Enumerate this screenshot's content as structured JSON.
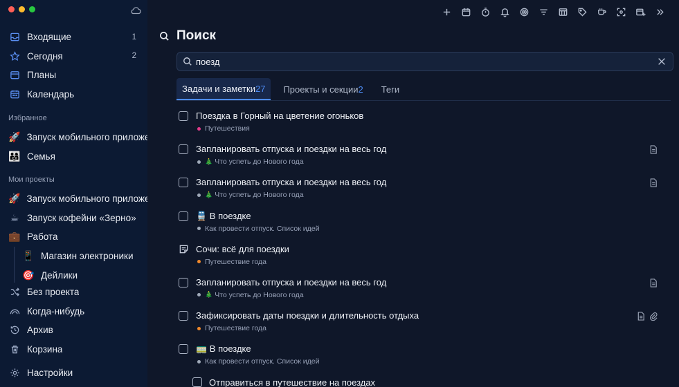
{
  "sidebar": {
    "items_top": [
      {
        "label": "Входящие",
        "count": "1",
        "icon": "inbox-icon"
      },
      {
        "label": "Сегодня",
        "count": "2",
        "icon": "star-icon"
      },
      {
        "label": "Планы",
        "count": "",
        "icon": "planner-icon"
      },
      {
        "label": "Календарь",
        "count": "",
        "icon": "calendar-icon"
      }
    ],
    "favorites_title": "Избранное",
    "favorites": [
      {
        "label": "Запуск мобильного приложения",
        "emoji": "🚀"
      },
      {
        "label": "Семья",
        "emoji": "👨‍👩‍👧"
      }
    ],
    "projects_title": "Мои проекты",
    "projects": [
      {
        "label": "Запуск мобильного приложения",
        "emoji": "🚀"
      },
      {
        "label": "Запуск кофейни «Зерно»",
        "emoji": "☕"
      },
      {
        "label": "Работа",
        "emoji": "💼"
      }
    ],
    "subprojects": [
      {
        "label": "Магазин электроники",
        "emoji": "📱"
      },
      {
        "label": "Дейлики",
        "emoji": "🎯"
      }
    ],
    "items_bottom": [
      {
        "label": "Без проекта",
        "icon": "shuffle-icon"
      },
      {
        "label": "Когда-нибудь",
        "icon": "rainbow-icon"
      },
      {
        "label": "Архив",
        "icon": "history-icon"
      },
      {
        "label": "Корзина",
        "icon": "trash-icon"
      }
    ],
    "settings_label": "Настройки"
  },
  "main": {
    "title": "Поиск",
    "search_value": "поезд",
    "tabs": [
      {
        "label": "Задачи и заметки",
        "count": "27",
        "active": true
      },
      {
        "label": "Проекты и секции",
        "count": "2",
        "active": false
      },
      {
        "label": "Теги",
        "count": "",
        "active": false
      }
    ],
    "results": [
      {
        "title": "Поездка в Горный на цветение огоньков",
        "project": "Путешествия",
        "dot": "#e23b8a",
        "emoji": "",
        "kind": "task",
        "icons": []
      },
      {
        "title": "Запланировать отпуска и поездки на весь год",
        "project": "Что успеть до Нового года",
        "dot": "#a0aab9",
        "emoji": "🎄",
        "kind": "task",
        "icons": [
          "note"
        ]
      },
      {
        "title": "Запланировать отпуска и поездки на весь год",
        "project": "Что успеть до Нового года",
        "dot": "#a0aab9",
        "emoji": "🎄",
        "kind": "task",
        "icons": [
          "note"
        ]
      },
      {
        "title": "🚆 В поездке",
        "project": "Как провести отпуск. Список идей",
        "dot": "#a0aab9",
        "emoji": "",
        "kind": "task",
        "icons": []
      },
      {
        "title": "Сочи: всё для поездки",
        "project": "Путешествие года",
        "dot": "#f0892b",
        "emoji": "",
        "kind": "note",
        "icons": []
      },
      {
        "title": "Запланировать отпуска и поездки на весь год",
        "project": "Что успеть до Нового года",
        "dot": "#a0aab9",
        "emoji": "🎄",
        "kind": "task",
        "icons": [
          "note"
        ]
      },
      {
        "title": "Зафиксировать даты поездки и длительность отдыха",
        "project": "Путешествие года",
        "dot": "#f0892b",
        "emoji": "",
        "kind": "task",
        "icons": [
          "note",
          "clip"
        ]
      },
      {
        "title": "🚃 В поездке",
        "project": "Как провести отпуск. Список идей",
        "dot": "#a0aab9",
        "emoji": "",
        "kind": "task",
        "icons": []
      }
    ],
    "last_row_title": "Отправиться в путешествие на поездах"
  },
  "colors": {
    "sidebar_bg": "#0c1a33",
    "main_bg": "#0f1729",
    "accent": "#4d8cf5"
  }
}
